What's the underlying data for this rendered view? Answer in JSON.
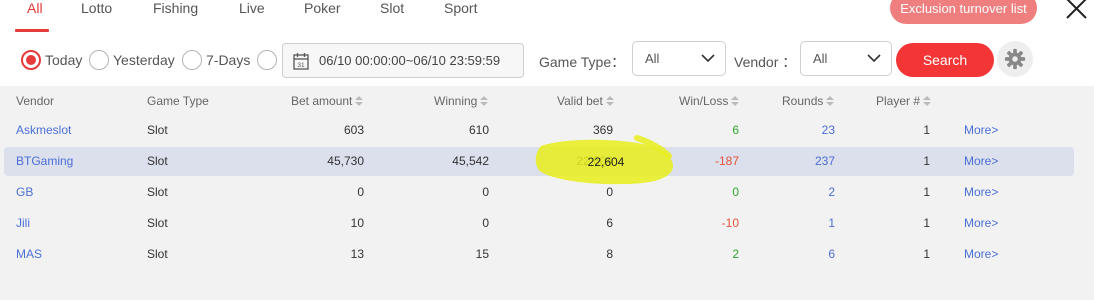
{
  "tabs": [
    {
      "label": "All",
      "active": true
    },
    {
      "label": "Lotto"
    },
    {
      "label": "Fishing"
    },
    {
      "label": "Live"
    },
    {
      "label": "Poker"
    },
    {
      "label": "Slot"
    },
    {
      "label": "Sport"
    }
  ],
  "exclusion_button": "Exclusion turnover list",
  "filters": {
    "radios": [
      {
        "label": "Today",
        "checked": true
      },
      {
        "label": "Yesterday"
      },
      {
        "label": "7-Days"
      },
      {
        "label": ""
      }
    ],
    "date_range": "06/10 00:00:00~06/10 23:59:59",
    "game_type_label": "Game Type：",
    "game_type_value": "All",
    "vendor_label": "Vendor ：",
    "vendor_value": "All",
    "search_label": "Search"
  },
  "table": {
    "headers": [
      "Vendor",
      "Game Type",
      "Bet amount",
      "Winning",
      "Valid bet",
      "Win/Loss",
      "Rounds",
      "Player #"
    ],
    "more_label": "More>",
    "rows": [
      {
        "vendor": "Askmeslot",
        "game_type": "Slot",
        "bet_amount": "603",
        "winning": "610",
        "valid_bet": "369",
        "win_loss": "6",
        "rounds": "23",
        "players": "1"
      },
      {
        "vendor": "BTGaming",
        "game_type": "Slot",
        "bet_amount": "45,730",
        "winning": "45,542",
        "valid_bet": "22,604",
        "win_loss": "-187",
        "rounds": "237",
        "players": "1"
      },
      {
        "vendor": "GB",
        "game_type": "Slot",
        "bet_amount": "0",
        "winning": "0",
        "valid_bet": "0",
        "win_loss": "0",
        "rounds": "2",
        "players": "1"
      },
      {
        "vendor": "Jili",
        "game_type": "Slot",
        "bet_amount": "10",
        "winning": "0",
        "valid_bet": "6",
        "win_loss": "-10",
        "rounds": "1",
        "players": "1"
      },
      {
        "vendor": "MAS",
        "game_type": "Slot",
        "bet_amount": "13",
        "winning": "15",
        "valid_bet": "8",
        "win_loss": "2",
        "rounds": "6",
        "players": "1"
      }
    ]
  },
  "colors": {
    "accent": "#e53b3b",
    "exclusion_bg": "#ef7f7f",
    "search_bg": "#f43535",
    "link": "#4a6fd6",
    "positive": "#2eaa2e",
    "negative": "#e5523a",
    "highlighter": "#e8ee1a"
  },
  "icons": {
    "close": "close-icon",
    "calendar": "calendar-icon",
    "dropdown": "chevron-down-icon",
    "settings": "gear-icon",
    "sort": "sort-icon"
  }
}
